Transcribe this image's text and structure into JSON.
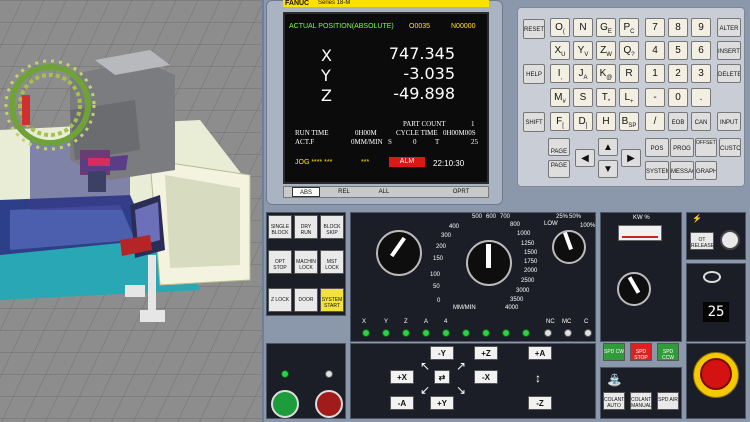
{
  "screen": {
    "brand": "FANUC",
    "series": "Series 18-M",
    "header": "ACTUAL POSITION(ABSOLUTE)",
    "program": "O0035",
    "sequence": "N00000",
    "axes": [
      {
        "name": "X",
        "value": "747.345"
      },
      {
        "name": "Y",
        "value": "-3.035"
      },
      {
        "name": "Z",
        "value": "-49.898"
      }
    ],
    "part_count_label": "PART COUNT",
    "part_count": "1",
    "run_time_label": "RUN TIME",
    "run_time": "0H00M",
    "cycle_time_label": "CYCLE TIME",
    "cycle_time": "0H00M00S",
    "actf_label": "ACT.F",
    "actf": "0MM/MIN",
    "s_label": "S",
    "s_value": "0",
    "t_label": "T",
    "t_value": "25",
    "mode": "JOG **** ***",
    "stars": "***",
    "alarm": "ALM",
    "clock": "22:10:30",
    "softkeys": [
      "ABS",
      "REL",
      "ALL",
      "",
      "OPRT"
    ]
  },
  "keyboard": {
    "reset": "RESET",
    "help": "HELP",
    "shift": "SHIFT",
    "page_up": "PAGE",
    "page_down": "PAGE",
    "alter": "ALTER",
    "insert": "INSERT",
    "delete": "DELETE",
    "eob": "EOB",
    "can": "CAN",
    "input": "INPUT",
    "pos": "POS",
    "prog": "PROG",
    "offset": "OFFSET SETTING",
    "custom": "CUSTOM",
    "system": "SYSTEM",
    "message": "MESSAGE",
    "graph": "GRAPH",
    "letters": [
      [
        "O",
        "N",
        "G",
        "P"
      ],
      [
        "X",
        "Y",
        "Z",
        "Q"
      ],
      [
        "I",
        "J",
        "K",
        "R"
      ],
      [
        "M",
        "S",
        "T",
        "L"
      ],
      [
        "F",
        "D",
        "H",
        "B"
      ]
    ],
    "letter_subs": [
      [
        "(",
        "",
        "E",
        "C"
      ],
      [
        "U",
        "V",
        "W",
        "?"
      ],
      [
        ",",
        "A",
        "@",
        ""
      ],
      [
        "#",
        "",
        "*",
        "+"
      ],
      [
        "[",
        "]",
        "",
        "SP"
      ]
    ],
    "numbers": [
      [
        "7",
        "8",
        "9"
      ],
      [
        "4",
        "5",
        "6"
      ],
      [
        "1",
        "2",
        "3"
      ],
      [
        "-",
        "0",
        "."
      ],
      [
        "/",
        "",
        ""
      ]
    ]
  },
  "controls": {
    "mode_buttons": [
      "SINGLE BLOCK",
      "DRY RUN",
      "BLOCK SKIP",
      "OPT STOP",
      "MACHIN LOCK",
      "MST LOCK",
      "Z LOCK",
      "DOOR",
      "SYSTEM START"
    ],
    "feed_label": "MM/MIN",
    "feed_ticks": [
      "0",
      "50",
      "100",
      "150",
      "200",
      "300",
      "400",
      "500",
      "600",
      "700",
      "800",
      "1000",
      "1250",
      "1500",
      "1750",
      "2000",
      "2500",
      "3000",
      "3500",
      "4000"
    ],
    "spindle_labels": [
      "LOW",
      "25%",
      "50%",
      "100%"
    ],
    "kw_label": "KW %",
    "ot_release": "OT RELEASE",
    "spd_buttons": [
      "SPD CW",
      "SPD STOP",
      "SPD CCW"
    ],
    "coolant_buttons": [
      "COLANT AUTO",
      "COLANT MANUAL",
      "SPD AIR"
    ],
    "tool_display": "25",
    "axis_leds": [
      "X",
      "Y",
      "Z",
      "A",
      "4",
      "NC",
      "MC",
      "C"
    ],
    "jog_buttons": [
      "-Y",
      "+Z",
      "+X",
      "-X",
      "+Y",
      "-A",
      "+A",
      "-Z"
    ]
  }
}
